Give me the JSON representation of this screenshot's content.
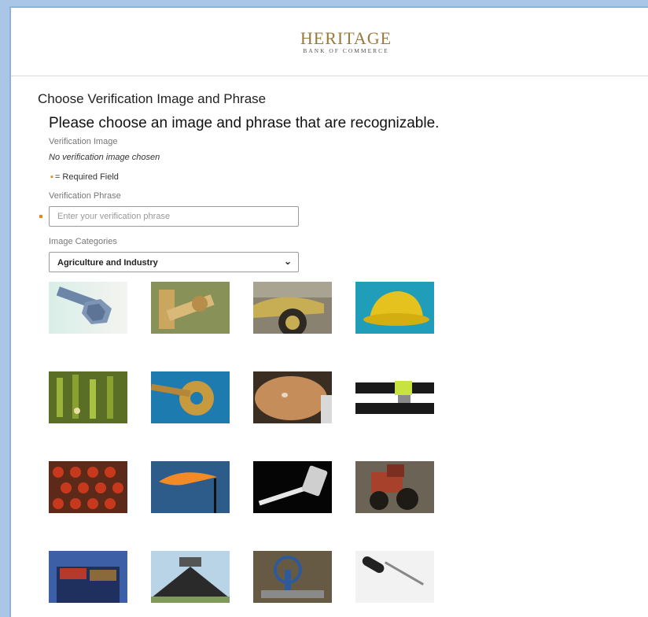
{
  "brand": {
    "name": "HERITAGE",
    "tagline": "BANK OF COMMERCE"
  },
  "page": {
    "title": "Choose Verification Image and Phrase",
    "subtitle": "Please choose an image and phrase that are recognizable."
  },
  "verification_image": {
    "label": "Verification Image",
    "status": "No verification image chosen"
  },
  "required_note": "= Required Field",
  "phrase": {
    "label": "Verification Phrase",
    "value": "",
    "placeholder": "Enter your verification phrase"
  },
  "categories": {
    "label": "Image Categories",
    "selected": "Agriculture and Industry"
  },
  "images": [
    {
      "name": "bolt-nut-image"
    },
    {
      "name": "gear-shaft-image"
    },
    {
      "name": "loader-wheel-image"
    },
    {
      "name": "hard-hat-image"
    },
    {
      "name": "green-machinery-image"
    },
    {
      "name": "cog-wheel-image"
    },
    {
      "name": "metal-disc-image"
    },
    {
      "name": "spirit-level-image"
    },
    {
      "name": "red-rollers-image"
    },
    {
      "name": "gas-flare-image"
    },
    {
      "name": "tape-measure-image"
    },
    {
      "name": "tractor-image"
    },
    {
      "name": "shipping-containers-image"
    },
    {
      "name": "factory-building-image"
    },
    {
      "name": "valve-wheel-image"
    },
    {
      "name": "screwdriver-image"
    }
  ],
  "colors": {
    "accent": "#e08a1e",
    "brand_gold": "#9a7a3c",
    "frame_blue": "#a9c6e6"
  }
}
